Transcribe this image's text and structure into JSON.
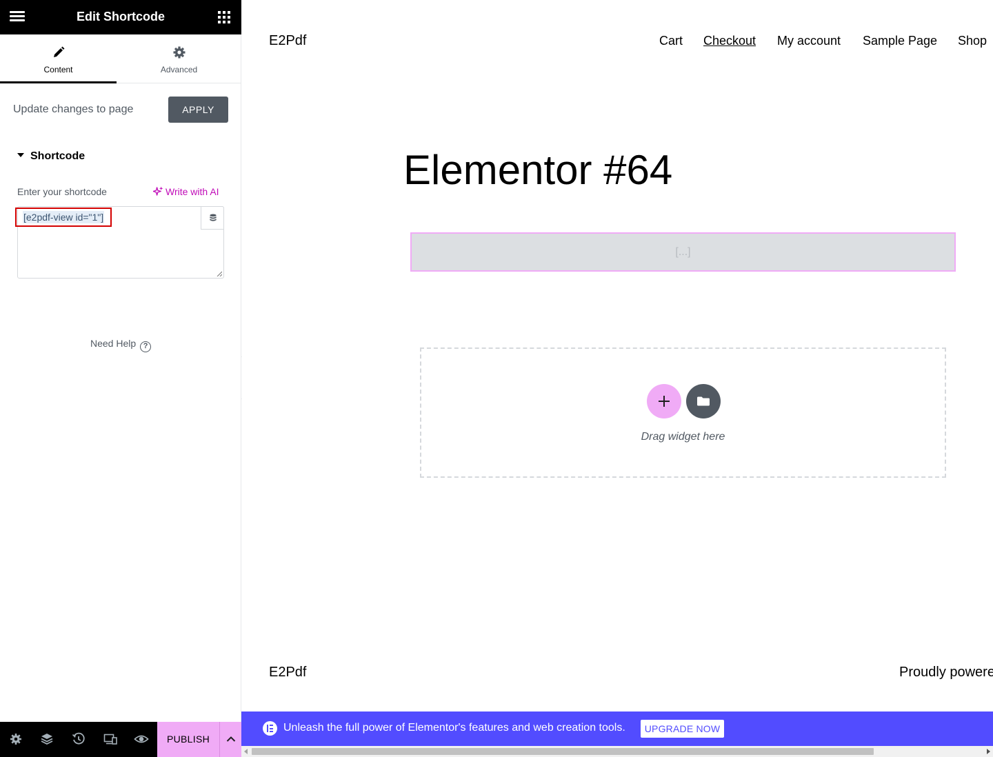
{
  "panel": {
    "header_title": "Edit Shortcode",
    "tabs": [
      {
        "label": "Content",
        "icon": "pencil-icon"
      },
      {
        "label": "Advanced",
        "icon": "gear-icon"
      }
    ],
    "update_label": "Update changes to page",
    "apply_label": "APPLY",
    "section_title": "Shortcode",
    "field_label": "Enter your shortcode",
    "ai_label": "Write with AI",
    "shortcode_value": "[e2pdf-view id=\"1\"]",
    "help_label": "Need Help",
    "help_mark": "?",
    "publish_label": "PUBLISH"
  },
  "preview": {
    "site_title": "E2Pdf",
    "nav": [
      "Cart",
      "Checkout",
      "My account",
      "Sample Page",
      "Shop"
    ],
    "page_title": "Elementor #64",
    "shortcode_placeholder": "[...]",
    "drop_text": "Drag widget here",
    "footer_title": "E2Pdf",
    "footer_credit": "Proudly powere"
  },
  "promo": {
    "message": "Unleash the full power of Elementor's features and web creation tools.",
    "button": "UPGRADE NOW"
  },
  "colors": {
    "accent_pink": "#f0abf6",
    "ai_magenta": "#c00bb8",
    "promo_blue": "#524cff",
    "panel_dark": "#000000",
    "highlight_red": "#d30000"
  }
}
